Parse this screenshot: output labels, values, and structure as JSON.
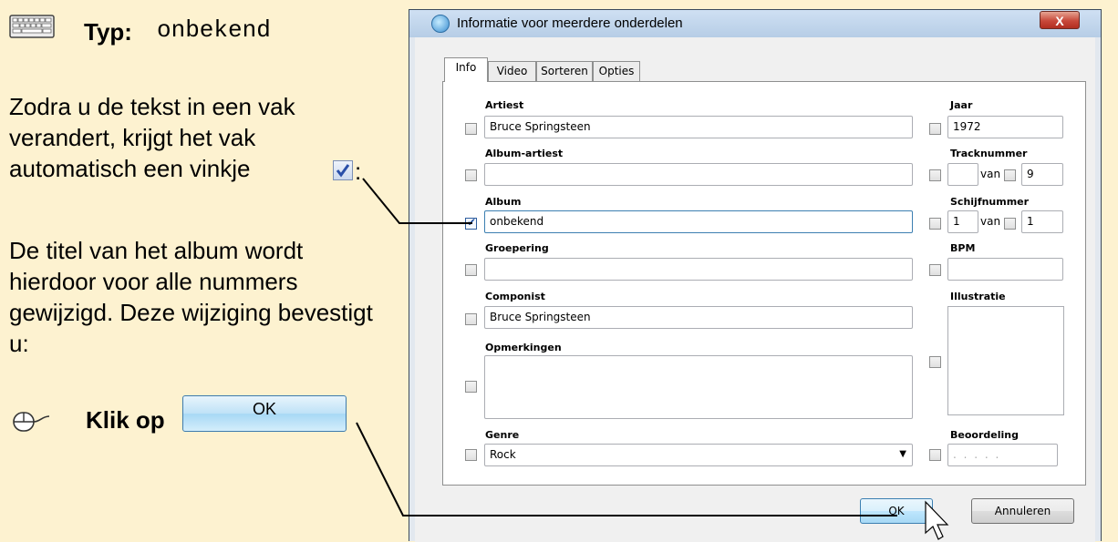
{
  "instruction": {
    "typ_label": "Typ:",
    "typ_value": "onbekend",
    "para1": "Zodra u de tekst in een vak verandert, krijgt het vak automatisch een vinkje",
    "para1_suffix": ":",
    "para2": "De titel van het album wordt hierdoor voor alle nummers gewijzigd. Deze wijziging bevestigt u:",
    "klik_label": "Klik op",
    "demo_button_label": "OK"
  },
  "dialog": {
    "title": "Informatie voor meerdere onderdelen",
    "close_symbol": "X",
    "tabs": [
      "Info",
      "Video",
      "Sorteren",
      "Opties"
    ],
    "fields": {
      "artiest": {
        "label": "Artiest",
        "value": "Bruce Springsteen"
      },
      "album_artiest": {
        "label": "Album-artiest",
        "value": ""
      },
      "album": {
        "label": "Album",
        "value": "onbekend"
      },
      "groepering": {
        "label": "Groepering",
        "value": ""
      },
      "componist": {
        "label": "Componist",
        "value": "Bruce Springsteen"
      },
      "opmerkingen": {
        "label": "Opmerkingen",
        "value": ""
      },
      "genre": {
        "label": "Genre",
        "value": "Rock"
      },
      "jaar": {
        "label": "Jaar",
        "value": "1972"
      },
      "tracknummer": {
        "label": "Tracknummer",
        "value": "",
        "van_label": "van",
        "of_value": "9"
      },
      "schijfnummer": {
        "label": "Schijfnummer",
        "value": "1",
        "van_label": "van",
        "of_value": "1"
      },
      "bpm": {
        "label": "BPM",
        "value": ""
      },
      "illustratie": {
        "label": "Illustratie"
      },
      "beoordeling": {
        "label": "Beoordeling",
        "value": ". . . . ."
      }
    },
    "ok_label": "OK",
    "cancel_label": "Annuleren"
  }
}
